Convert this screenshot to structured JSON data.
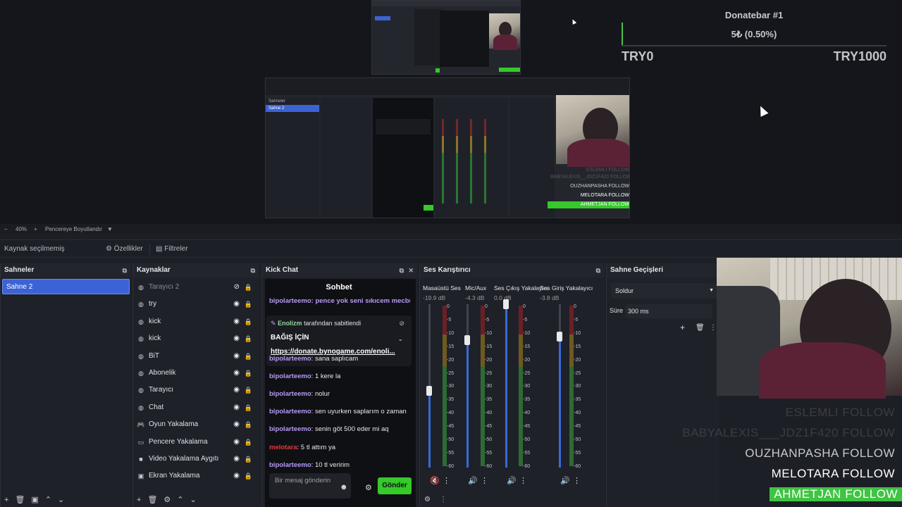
{
  "preview": {
    "zoom": "40%",
    "fit_label": "Pencereye Boyutlandır",
    "mini_overlay": [
      "ESLEMLI FOLLOW",
      "BABYALEXIS__JDZ1F420 FOLLOW",
      "OUZHANPASHA FOLLOW",
      "MELOTARA FOLLOW",
      "AHMETJAN FOLLOW"
    ],
    "mini_scene": "Sahne 2"
  },
  "donatebar": {
    "title": "Donatebar #1",
    "amount": "5₺ (0.50%)",
    "progress_percent": 0.5,
    "min_label": "TRY0",
    "max_label": "TRY1000",
    "fill_color": "#49c24a"
  },
  "follow_overlay": [
    {
      "name": "ESLEMLI",
      "suffix": "FOLLOW",
      "state": "faded"
    },
    {
      "name": "BABYALEXIS___JDZ1F420",
      "suffix": "FOLLOW",
      "state": "faded"
    },
    {
      "name": "OUZHANPASHA",
      "suffix": "FOLLOW",
      "state": "normal"
    },
    {
      "name": "MELOTARA",
      "suffix": "FOLLOW",
      "state": "bright"
    },
    {
      "name": "AHMETJAN",
      "suffix": "FOLLOW",
      "state": "highlight"
    }
  ],
  "source_bar": {
    "no_source": "Kaynak seçilmemiş",
    "properties": "Özellikler",
    "filters": "Filtreler"
  },
  "scenes": {
    "title": "Sahneler",
    "items": [
      {
        "label": "Sahne 2",
        "selected": true
      }
    ]
  },
  "sources": {
    "title": "Kaynaklar",
    "items": [
      {
        "label": "Tarayıcı 2",
        "icon": "globe-icon",
        "hidden": true
      },
      {
        "label": "try",
        "icon": "globe-icon",
        "hidden": false
      },
      {
        "label": "kick",
        "icon": "globe-icon",
        "hidden": false
      },
      {
        "label": "kick",
        "icon": "globe-icon",
        "hidden": false
      },
      {
        "label": "BiT",
        "icon": "globe-icon",
        "hidden": false
      },
      {
        "label": "Abonelik",
        "icon": "globe-icon",
        "hidden": false
      },
      {
        "label": "Tarayıcı",
        "icon": "globe-icon",
        "hidden": false
      },
      {
        "label": "Chat",
        "icon": "globe-icon",
        "hidden": false
      },
      {
        "label": "Oyun Yakalama",
        "icon": "gamepad-icon",
        "hidden": false
      },
      {
        "label": "Pencere Yakalama",
        "icon": "window-icon",
        "hidden": false
      },
      {
        "label": "Video Yakalama Aygıtı",
        "icon": "camera-icon",
        "hidden": false
      },
      {
        "label": "Ekran Yakalama",
        "icon": "monitor-icon",
        "hidden": false
      }
    ]
  },
  "chat": {
    "dock_title": "Kick Chat",
    "header": "Sohbet",
    "top_cut": "bipolarteemo: pence yok seni sıkıcem mecbur",
    "pinned": {
      "by": "Enolizm",
      "by_suffix": "tarafından sabitlendi",
      "title": "BAĞIŞ İÇİN",
      "link": "https://donate.bynogame.com/enoli..."
    },
    "messages": [
      {
        "user": "bipolarteemo",
        "text": "sana saplıcam",
        "color": "#b59bf5"
      },
      {
        "user": "bipolarteemo",
        "text": "1 kere la",
        "color": "#b59bf5"
      },
      {
        "user": "bipolarteemo",
        "text": "nolur",
        "color": "#b59bf5"
      },
      {
        "user": "bipolarteemo",
        "text": "sen uyurken saplarım o zaman",
        "color": "#b59bf5"
      },
      {
        "user": "bipolarteemo",
        "text": "senin göt 500 eder mi aq",
        "color": "#b59bf5"
      },
      {
        "user": "melotara",
        "text": "5 tl attım ya",
        "color": "#e8383d"
      },
      {
        "user": "bipolarteemo",
        "text": "10 tl veririm",
        "color": "#b59bf5"
      }
    ],
    "input_placeholder": "Bir mesaj gönderin",
    "send_label": "Gönder"
  },
  "mixer": {
    "title": "Ses Karıştırıcı",
    "channels": [
      {
        "name": "Masaüstü Ses",
        "db": "-19.9 dB",
        "level": 0.47,
        "muted": true
      },
      {
        "name": "Mic/Aux",
        "db": "-4.3 dB",
        "level": 0.78,
        "muted": false
      },
      {
        "name": "Ses Çıkış Yakalayıcı",
        "db": "0.0 dB",
        "level": 1.0,
        "muted": false
      },
      {
        "name": "Ses Giriş Yakalayıcı",
        "db": "-3.8 dB",
        "level": 0.8,
        "muted": false
      }
    ],
    "scale": [
      "0",
      "-5",
      "-10",
      "-15",
      "-20",
      "-25",
      "-30",
      "-35",
      "-40",
      "-45",
      "-50",
      "-55",
      "-60"
    ]
  },
  "transitions": {
    "title": "Sahne Geçişleri",
    "selected": "Soldur",
    "duration_label": "Süre",
    "duration_value": "300 ms"
  }
}
